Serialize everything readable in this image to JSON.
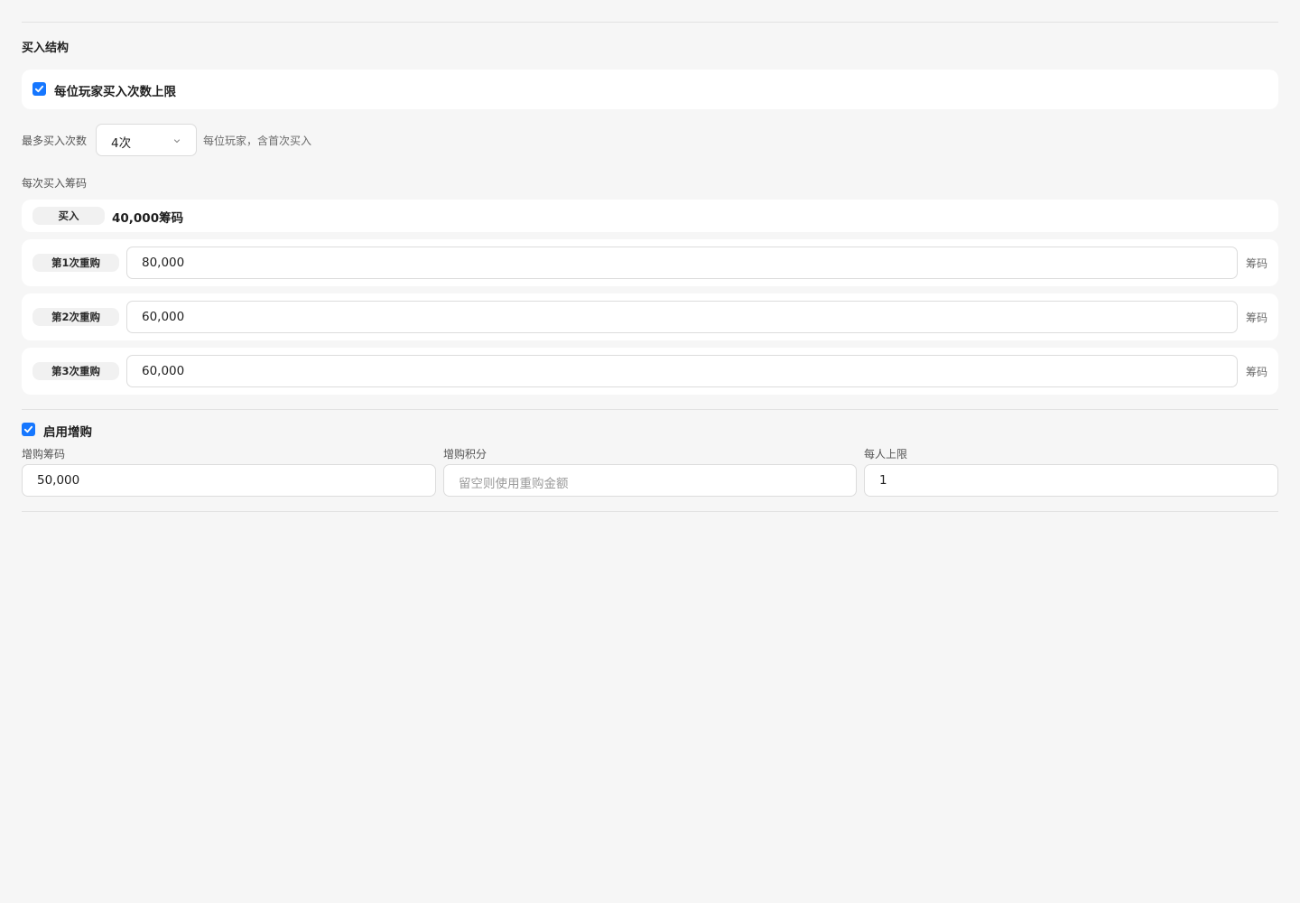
{
  "section_title": "买入结构",
  "limit_checkbox": {
    "label": "每位玩家买入次数上限",
    "checked": true
  },
  "max_buyins": {
    "label": "最多买入次数",
    "value": "4次",
    "hint": "每位玩家，含首次买入"
  },
  "per_buyin": {
    "label": "每次买入筹码",
    "initial": {
      "tag": "买入",
      "value": "40,000筹码"
    },
    "rebuys": [
      {
        "tag": "第1次重购",
        "value": "80,000",
        "unit": "筹码"
      },
      {
        "tag": "第2次重购",
        "value": "60,000",
        "unit": "筹码"
      },
      {
        "tag": "第3次重购",
        "value": "60,000",
        "unit": "筹码"
      }
    ]
  },
  "addon": {
    "enable_label": "启用增购",
    "checked": true,
    "chips": {
      "label": "增购筹码",
      "value": "50,000"
    },
    "points": {
      "label": "增购积分",
      "placeholder": "留空则使用重购金额"
    },
    "limit": {
      "label": "每人上限",
      "value": "1"
    }
  },
  "colors": {
    "accent": "#1677ff",
    "background": "#f6f6f6",
    "card": "#ffffff"
  }
}
